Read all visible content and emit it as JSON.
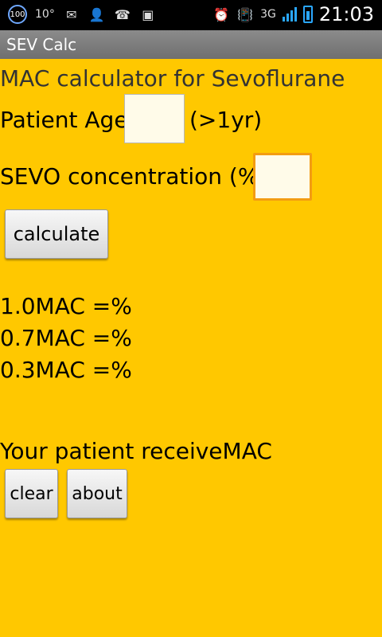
{
  "status_bar": {
    "time": "21:03",
    "left": {
      "badge": "100",
      "temp": "10°"
    },
    "network_label": "3G"
  },
  "app_bar": {
    "title": "SEV Calc"
  },
  "main": {
    "heading": "MAC calculator for Sevoflurane",
    "age": {
      "label": "Patient Age",
      "hint": "(>1yr)",
      "value": ""
    },
    "concentration": {
      "label": "SEVO concentration (%)",
      "value": ""
    },
    "buttons": {
      "calculate": "calculate",
      "clear": "clear",
      "about": "about"
    },
    "results": {
      "mac_1_0": "1.0MAC =%",
      "mac_0_7": "0.7MAC =%",
      "mac_0_3": "0.3MAC =%"
    },
    "receive_text": "Your patient receiveMAC"
  },
  "colors": {
    "background": "#FFC800",
    "title_bar": "#7A7A7A",
    "focus_border": "#F39C12",
    "input_bg": "#FFFBE9"
  },
  "icons": {
    "status_left": [
      "hundred-badge-icon",
      "mail-icon",
      "contact-add-icon",
      "phone-icon",
      "sd-card-icon"
    ],
    "status_right": [
      "alarm-icon",
      "vibrate-icon",
      "signal-bars-icon",
      "battery-icon"
    ]
  }
}
